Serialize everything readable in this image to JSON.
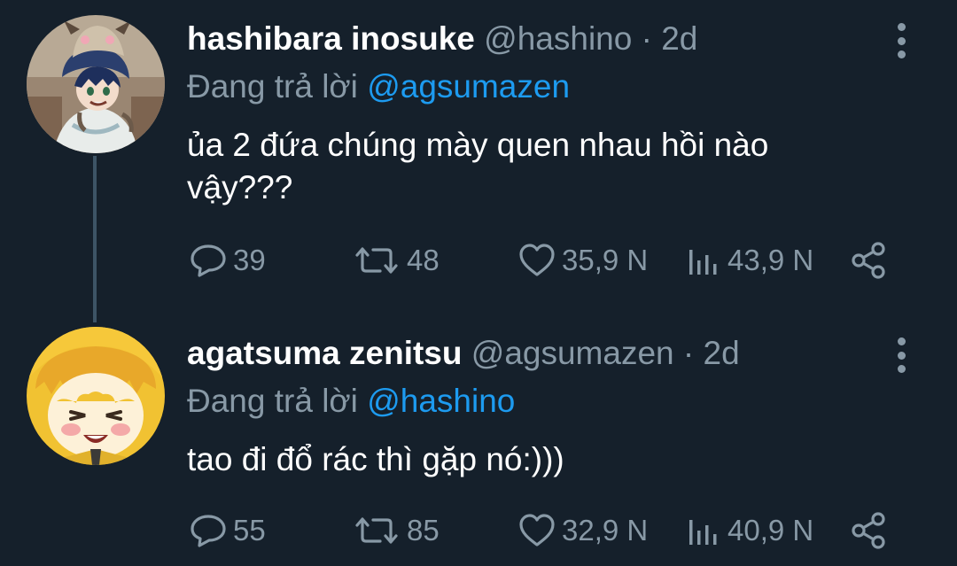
{
  "tweets": [
    {
      "display_name": "hashibara inosuke",
      "handle": "@hashino",
      "separator": "·",
      "time": "2d",
      "reply_prefix": "Đang trả lời",
      "reply_to": "@agsumazen",
      "text": "ủa 2 đứa chúng mày quen nhau hồi nào vậy???",
      "replies": "39",
      "retweets": "48",
      "likes": "35,9 N",
      "views": "43,9 N",
      "avatar_icon": "boar-mask-avatar"
    },
    {
      "display_name": "agatsuma zenitsu",
      "handle": "@agsumazen",
      "separator": "·",
      "time": "2d",
      "reply_prefix": "Đang trả lời",
      "reply_to": "@hashino",
      "text": "tao đi đổ rác thì gặp nó:)))",
      "replies": "55",
      "retweets": "85",
      "likes": "32,9 N",
      "views": "40,9 N",
      "avatar_icon": "blonde-boy-avatar"
    }
  ],
  "colors": {
    "background": "#15202b",
    "text": "#ffffff",
    "secondary": "#8899a6",
    "mention": "#1d9bf0",
    "thread_line": "#3d5466"
  }
}
